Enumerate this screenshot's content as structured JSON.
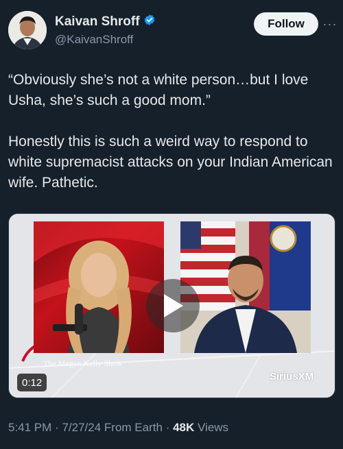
{
  "author": {
    "display_name": "Kaivan Shroff",
    "handle": "@KaivanShroff",
    "verified_color": "#1d9bf0"
  },
  "actions": {
    "follow_label": "Follow",
    "more_label": "···"
  },
  "tweet": {
    "text": "“Obviously she’s not a white person…but I love Usha, she’s such a good mom.”\n\nHonestly this is such a weird way to respond to white supremacist attacks on your Indian American wife. Pathetic."
  },
  "media": {
    "duration": "0:12",
    "brand": "SiriusXM",
    "show_mark": "The Megyn Kelly Show"
  },
  "meta": {
    "time": "5:41 PM",
    "date": "7/27/24",
    "source": "From Earth",
    "views_count": "48K",
    "views_label": "Views",
    "separator": "·"
  },
  "colors": {
    "background": "#15202b",
    "text_primary": "#e7e9ea",
    "text_secondary": "#8b98a5",
    "accent": "#1d9bf0"
  }
}
